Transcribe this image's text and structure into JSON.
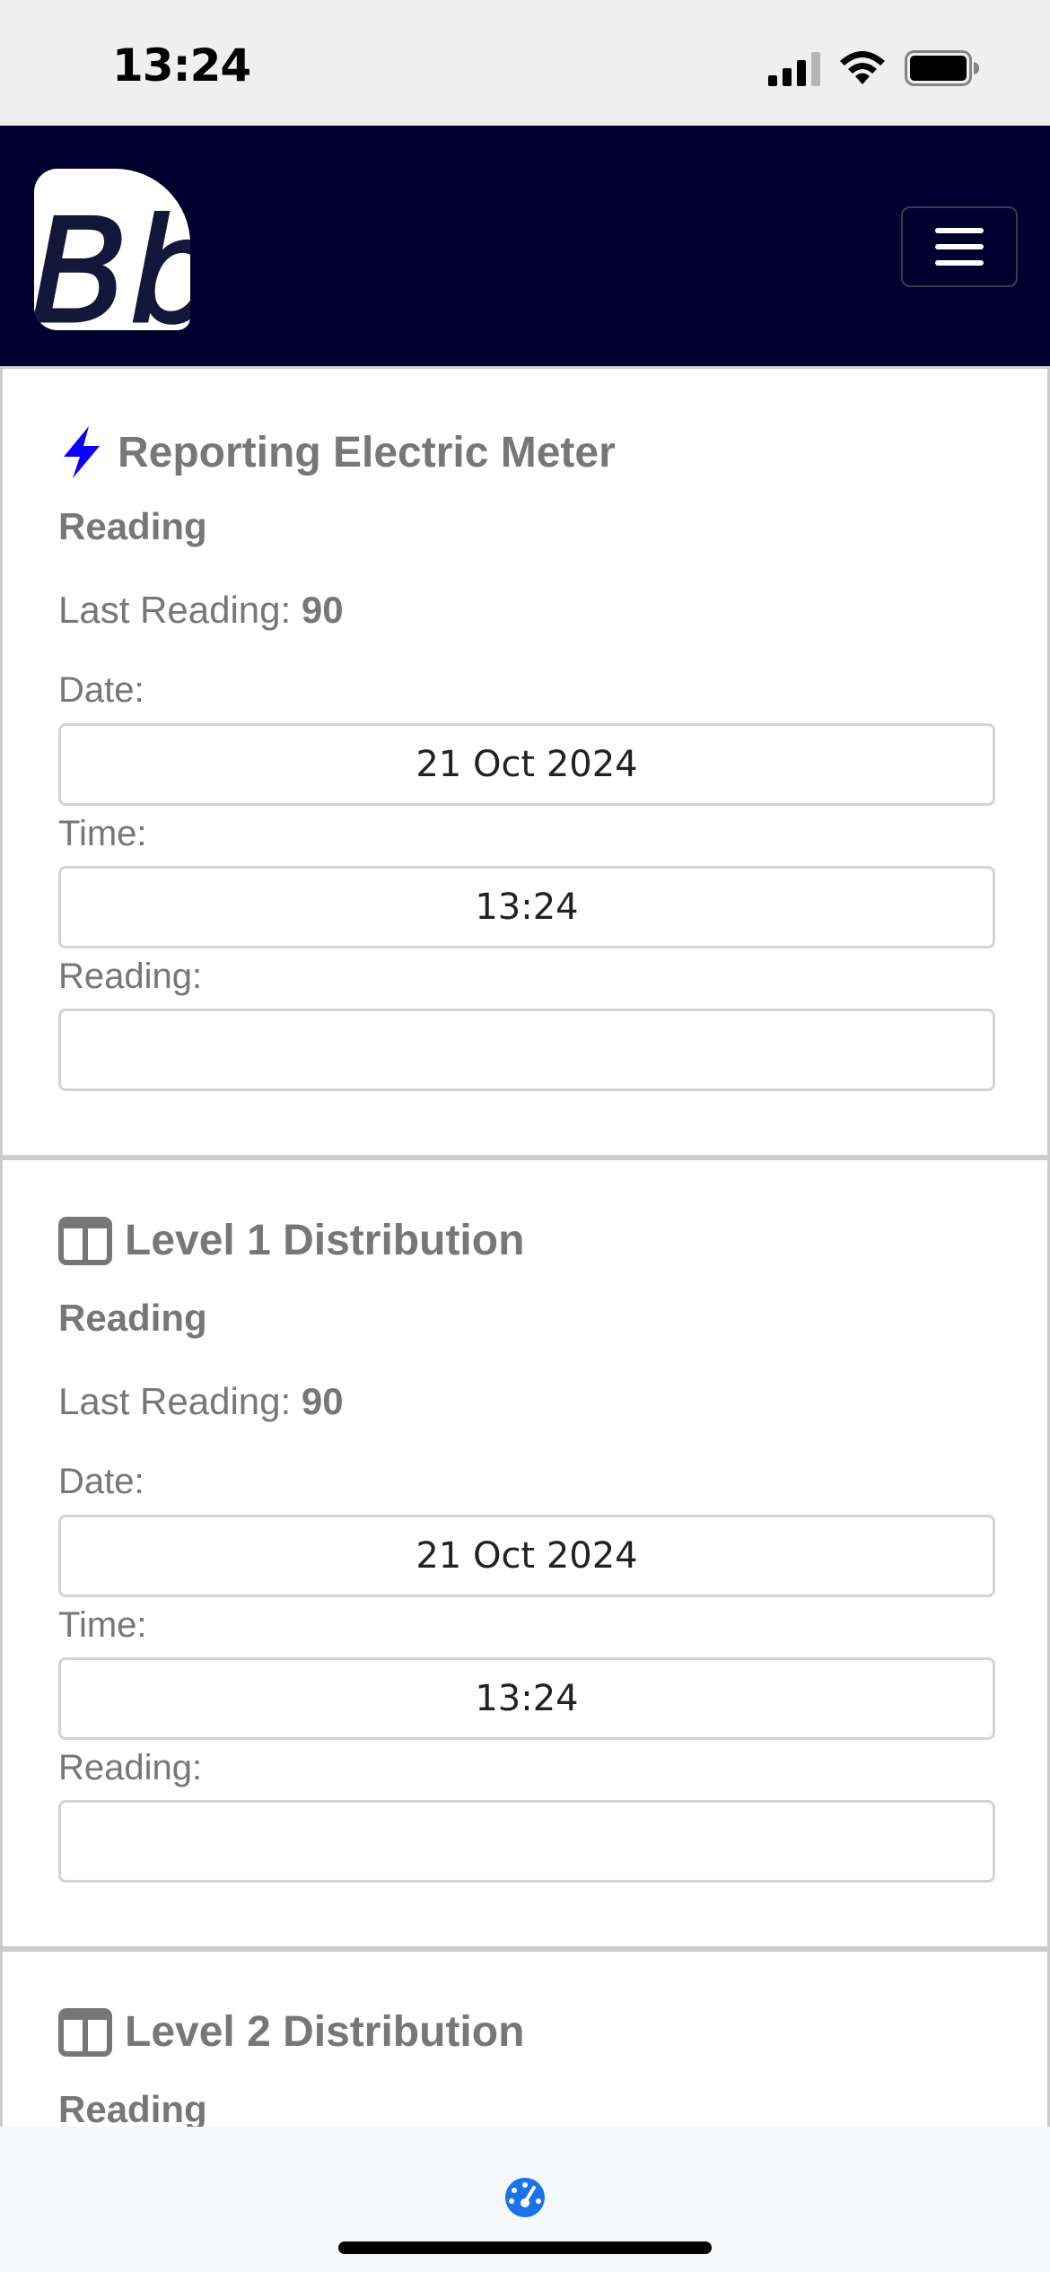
{
  "status_bar": {
    "time": "13:24",
    "icons": [
      "cellular-signal-icon",
      "wifi-icon",
      "battery-icon"
    ]
  },
  "navbar": {
    "logo_text": "Bb",
    "menu_icon": "hamburger-menu-icon",
    "background_color": "#00002e"
  },
  "cards": [
    {
      "title": "Reporting Electric Meter",
      "icon": "lightning-bolt-icon",
      "icon_color": "#0a00ff",
      "section": "Reading",
      "last_reading_label": "Last Reading:",
      "last_reading_value": "90",
      "date_label": "Date:",
      "date_value": "21 Oct 2024",
      "time_label": "Time:",
      "time_value": "13:24",
      "reading_label": "Reading:",
      "reading_value": ""
    },
    {
      "title": "Level 1 Distribution",
      "icon": "distribution-board-icon",
      "section": "Reading",
      "last_reading_label": "Last Reading:",
      "last_reading_value": "90",
      "date_label": "Date:",
      "date_value": "21 Oct 2024",
      "time_label": "Time:",
      "time_value": "13:24",
      "reading_label": "Reading:",
      "reading_value": ""
    },
    {
      "title": "Level 2 Distribution",
      "icon": "distribution-board-icon",
      "section": "Reading"
    }
  ],
  "bottom_bar": {
    "icon": "dashboard-gauge-icon",
    "icon_color": "#1a73e8"
  }
}
